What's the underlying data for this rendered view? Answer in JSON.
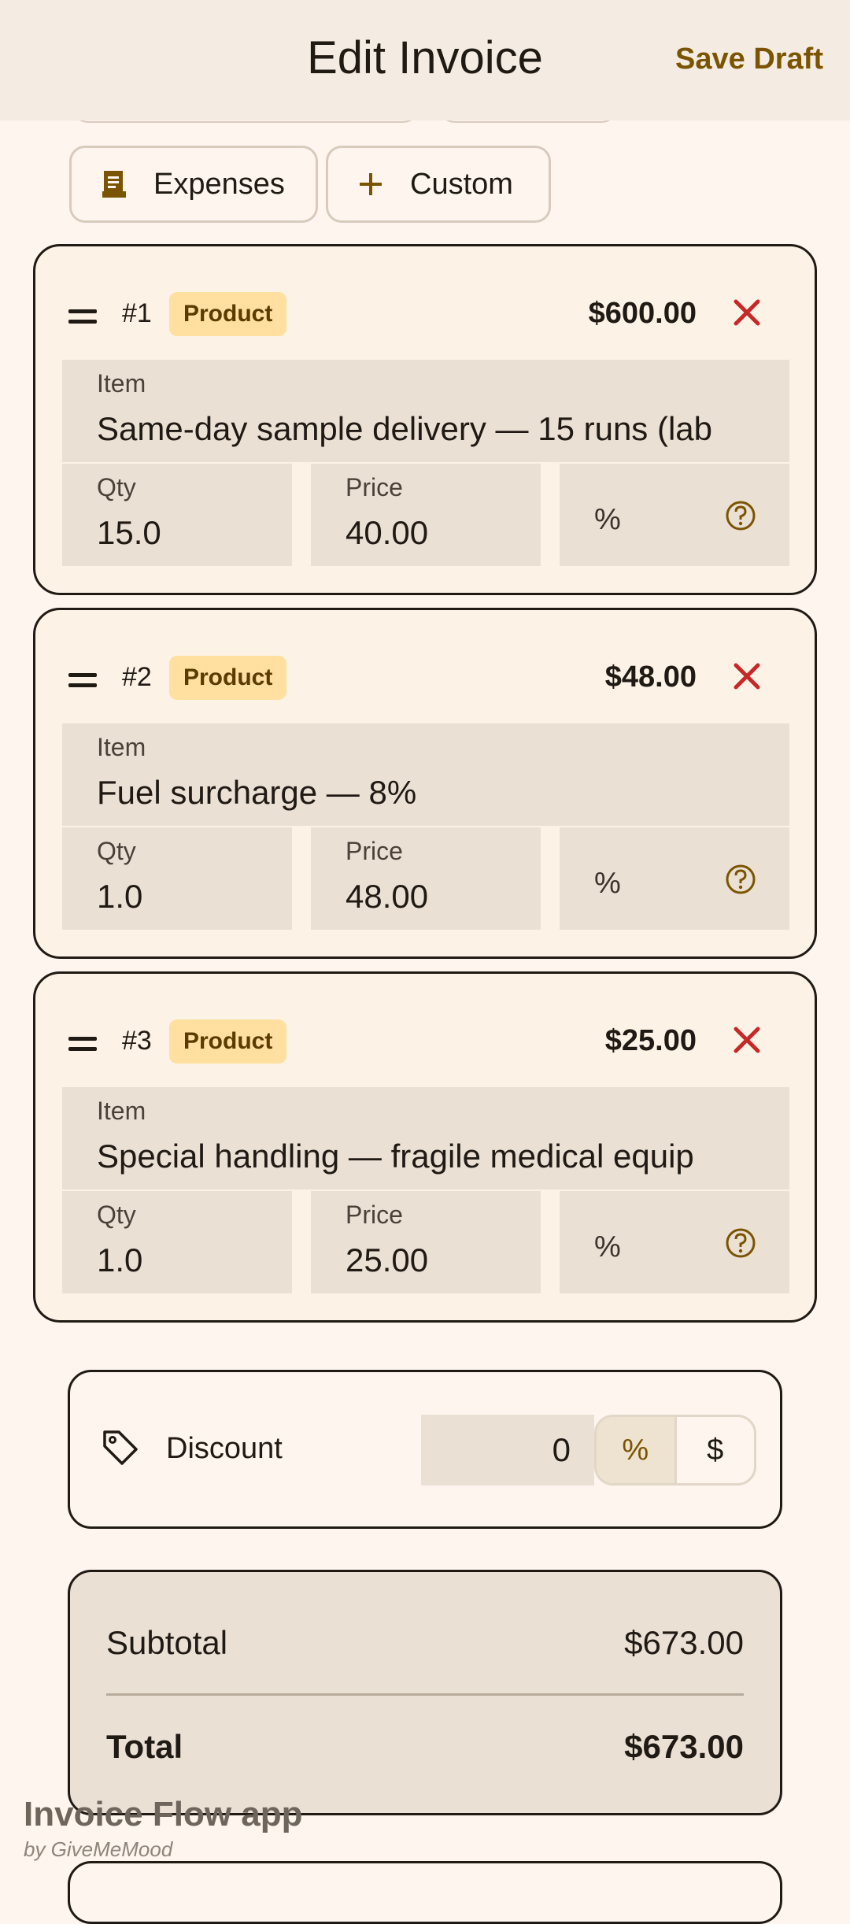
{
  "header": {
    "title": "Edit Invoice",
    "save_label": "Save Draft"
  },
  "chips": [
    {
      "label": "Expenses",
      "icon": "receipt-icon"
    },
    {
      "label": "Custom",
      "icon": "plus-icon"
    }
  ],
  "items": [
    {
      "num": "#1",
      "badge": "Product",
      "amount": "$600.00",
      "item_label": "Item",
      "item": "Same-day sample delivery — 15 runs (lab",
      "qty_label": "Qty",
      "qty": "15.0",
      "price_label": "Price",
      "price": "40.00",
      "pct": "%"
    },
    {
      "num": "#2",
      "badge": "Product",
      "amount": "$48.00",
      "item_label": "Item",
      "item": "Fuel surcharge — 8%",
      "qty_label": "Qty",
      "qty": "1.0",
      "price_label": "Price",
      "price": "48.00",
      "pct": "%"
    },
    {
      "num": "#3",
      "badge": "Product",
      "amount": "$25.00",
      "item_label": "Item",
      "item": "Special handling — fragile medical equip",
      "qty_label": "Qty",
      "qty": "1.0",
      "price_label": "Price",
      "price": "25.00",
      "pct": "%"
    }
  ],
  "discount": {
    "label": "Discount",
    "value": "0",
    "percent": "%",
    "dollar": "$"
  },
  "totals": {
    "subtotal_label": "Subtotal",
    "subtotal": "$673.00",
    "total_label": "Total",
    "total": "$673.00"
  },
  "brand": {
    "name": "Invoice Flow app",
    "by": "by GiveMeMood"
  },
  "colors": {
    "accent": "#7a5400",
    "danger": "#c62828",
    "badge_bg": "#ffe0a0"
  }
}
